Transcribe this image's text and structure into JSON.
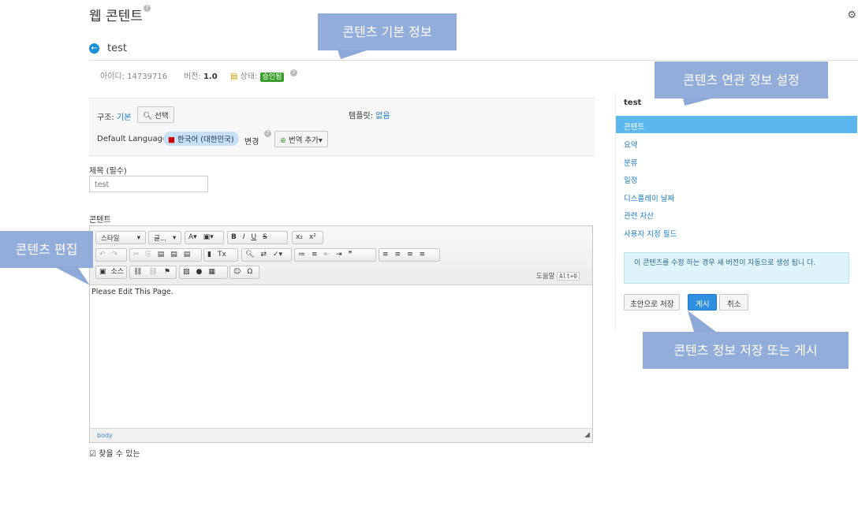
{
  "header": {
    "title": "웹 콘텐트",
    "help": "?",
    "article_title": "test"
  },
  "meta": {
    "id_label": "아이디:",
    "id_value": "14739716",
    "version_label": "버전:",
    "version_value": "1.0",
    "status_label": "상태:",
    "status_value": "승인됨"
  },
  "structure": {
    "label": "구조:",
    "value": "기본",
    "select_btn": "선택",
    "template_label": "템플릿:",
    "template_value": "없음",
    "lang_label": "Default Language:",
    "lang_value": "한국어 (대한민국)",
    "lang_change": "변경",
    "add_translation": "번역 추가"
  },
  "title_field": {
    "label": "제목 (필수)",
    "value": "test"
  },
  "content_label": "콘텐트",
  "editor": {
    "style_combo": "스타일",
    "font_combo": "글...",
    "source_btn": "소스",
    "help_label": "도움말",
    "help_key": "Alt+0",
    "body_text": "Please Edit This Page.",
    "path": "body"
  },
  "searchable_label": "찾을 수 있는",
  "sidebar": {
    "title": "test",
    "items": [
      "콘텐트",
      "요약",
      "분류",
      "일정",
      "디스플레이 날짜",
      "관련 자산",
      "사용자 지정 필드"
    ],
    "info": "이 콘텐츠를 수정 하는 경우 새 버전이 자동으로 생성 됩니 다.",
    "save_draft": "초안으로 저장",
    "publish": "게시",
    "cancel": "취소"
  },
  "callouts": {
    "basic_info": "콘텐츠 기본 정보",
    "related_info": "콘텐츠 연관 정보 설정",
    "edit": "콘텐츠 편집",
    "save_publish": "콘텐츠 정보 저장 또는 게시"
  },
  "colors": {
    "accent": "#1a8fd9",
    "active_nav": "#5bb7ee",
    "callout": "#8da9d9",
    "status": "#3a9e2e"
  }
}
